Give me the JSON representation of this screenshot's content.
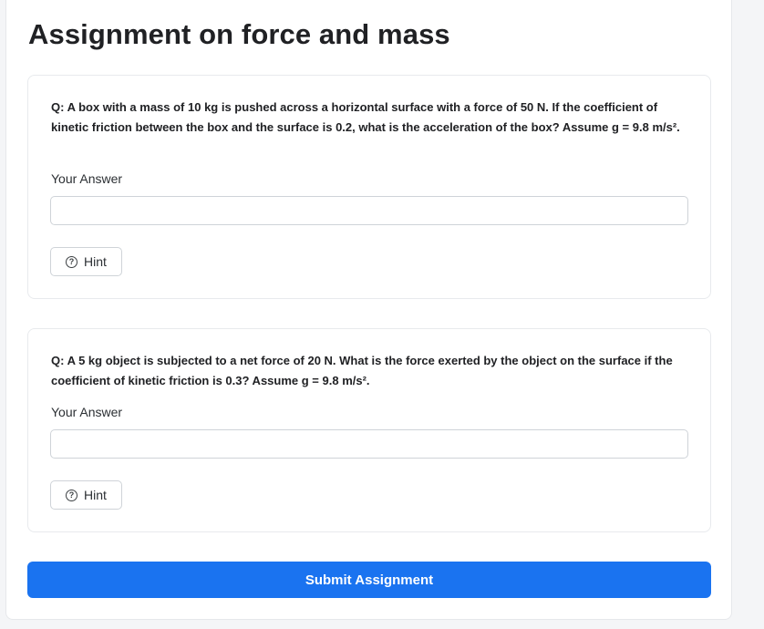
{
  "page": {
    "title": "Assignment on force and mass"
  },
  "questions": [
    {
      "text": "Q: A box with a mass of 10 kg is pushed across a horizontal surface with a force of 50 N. If the coefficient of kinetic friction between the box and the surface is 0.2, what is the acceleration of the box? Assume g = 9.8 m/s².",
      "answer_label": "Your Answer",
      "answer_value": "",
      "answer_placeholder": "",
      "hint_label": "Hint",
      "hint_icon": "question-circle-icon"
    },
    {
      "text": "Q: A 5 kg object is subjected to a net force of 20 N. What is the force exerted by the object on the surface if the coefficient of kinetic friction is 0.3? Assume g = 9.8 m/s².",
      "answer_label": "Your Answer",
      "answer_value": "",
      "answer_placeholder": "",
      "hint_label": "Hint",
      "hint_icon": "question-circle-icon"
    }
  ],
  "submit": {
    "label": "Submit Assignment"
  },
  "colors": {
    "accent": "#1a73f0",
    "background": "#f4f5f7",
    "card": "#ffffff"
  }
}
